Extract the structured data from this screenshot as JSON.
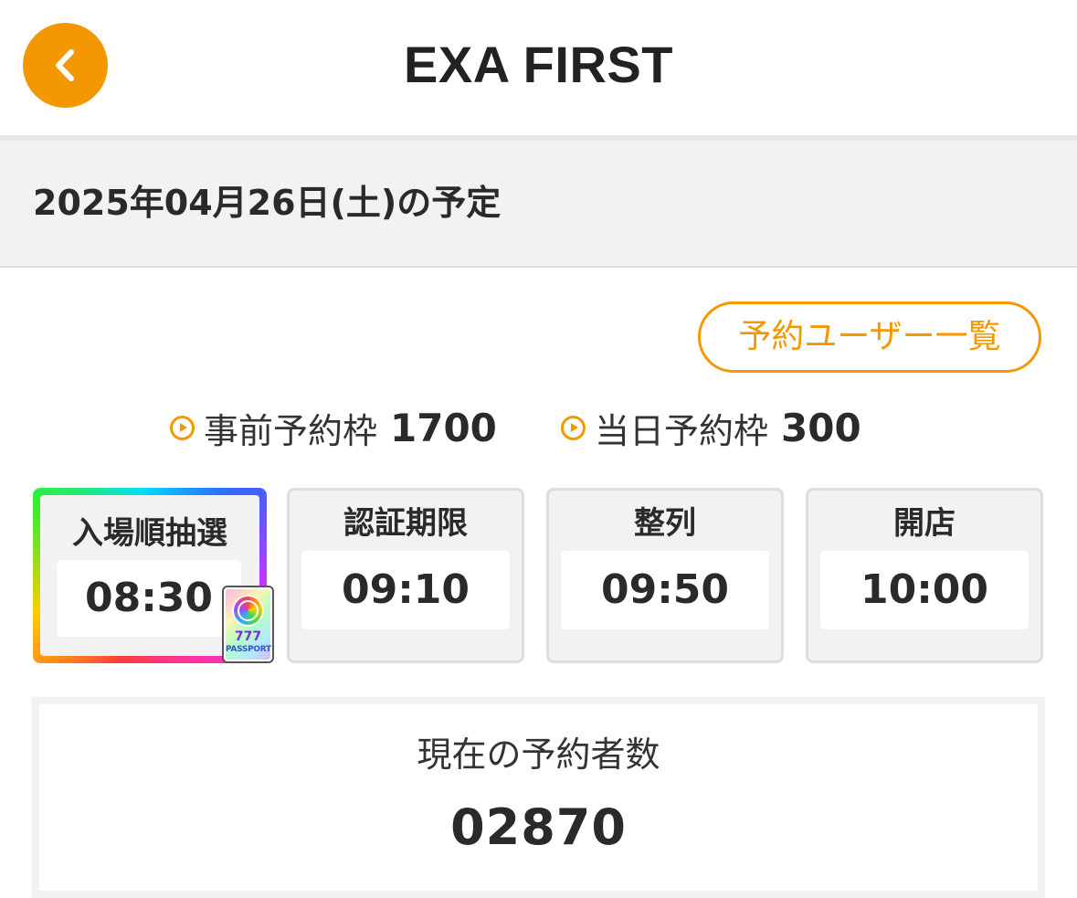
{
  "header": {
    "title": "EXA FIRST",
    "back_icon": "chevron-left-icon",
    "accent_color": "#f39800"
  },
  "schedule": {
    "date_title": "2025年04月26日(土)の予定"
  },
  "actions": {
    "reserved_users_label": "予約ユーザー一覧"
  },
  "slots": [
    {
      "label": "事前予約枠",
      "value": "1700",
      "icon": "play-circle-icon"
    },
    {
      "label": "当日予約枠",
      "value": "300",
      "icon": "play-circle-icon"
    }
  ],
  "timeline": [
    {
      "label": "入場順抽選",
      "time": "08:30",
      "highlight": "rainbow-border",
      "badge": "777-passport-icon"
    },
    {
      "label": "認証期限",
      "time": "09:10"
    },
    {
      "label": "整列",
      "time": "09:50"
    },
    {
      "label": "開店",
      "time": "10:00"
    }
  ],
  "passport_badge": {
    "number": "777",
    "word": "PASSPORT"
  },
  "reservation_count": {
    "label": "現在の予約者数",
    "value": "02870"
  }
}
